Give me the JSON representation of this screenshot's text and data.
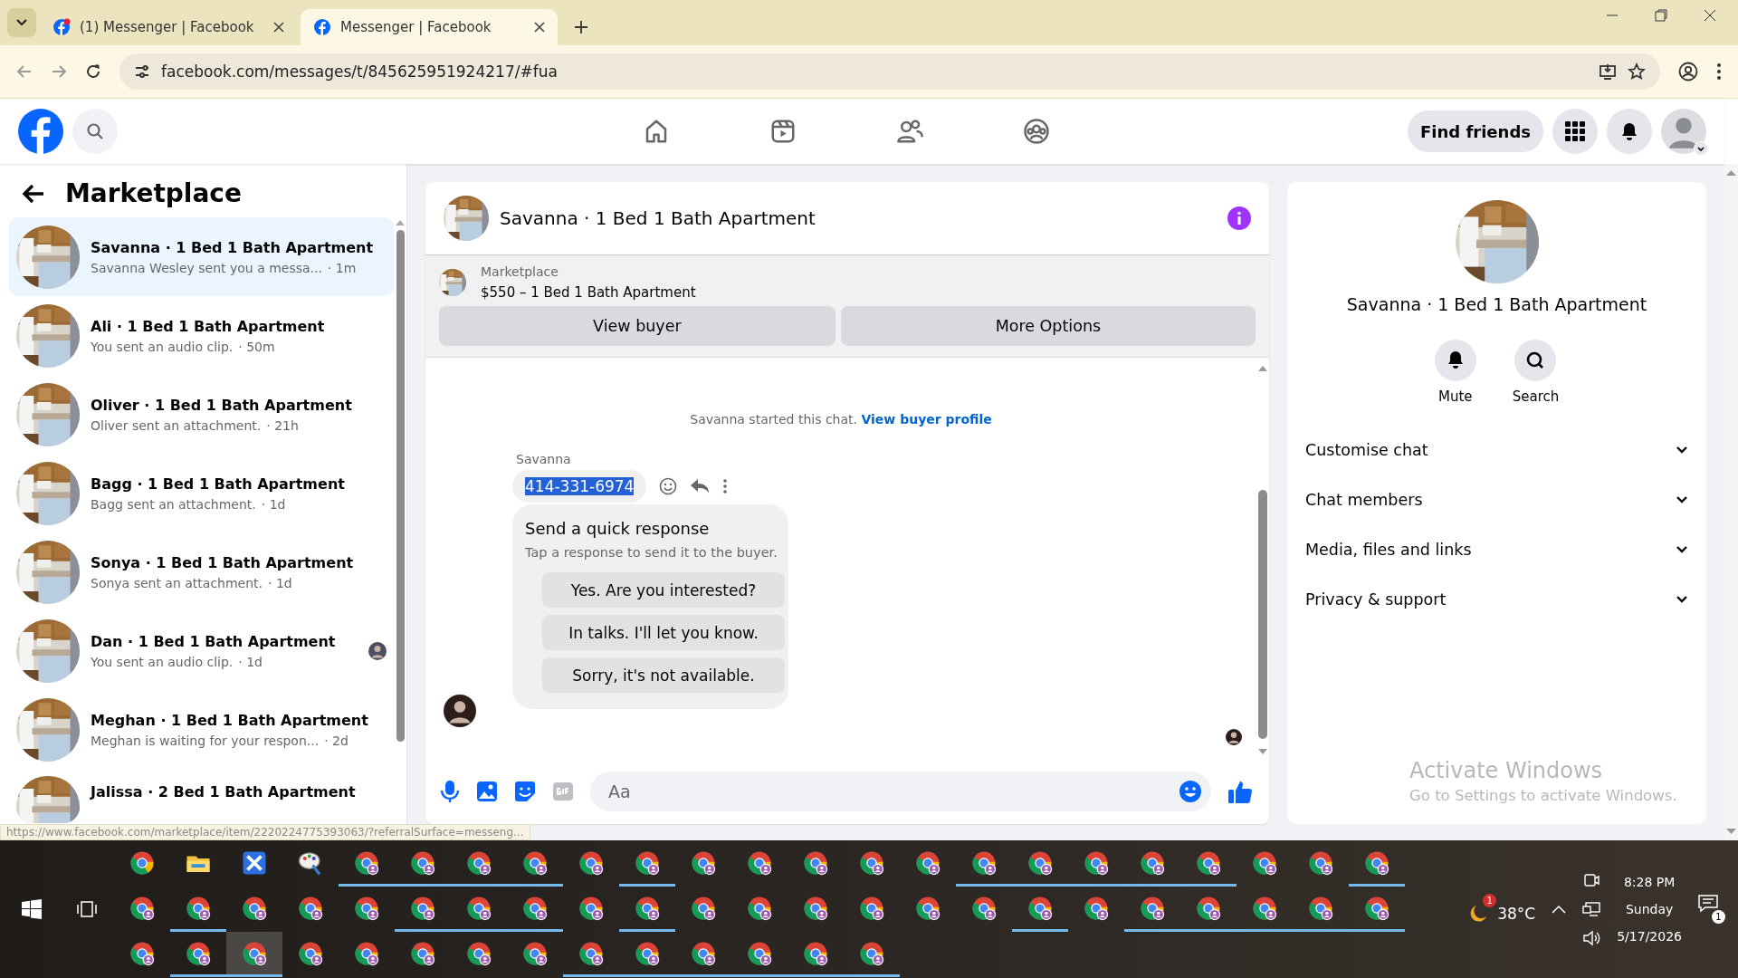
{
  "browser": {
    "tabs": [
      {
        "title": "(1) Messenger | Facebook",
        "selected": false,
        "notification": true
      },
      {
        "title": "Messenger | Facebook",
        "selected": true,
        "notification": false
      }
    ],
    "url": "facebook.com/messages/t/845625951924217/#fua"
  },
  "header": {
    "nav": [
      {
        "kind": "home"
      },
      {
        "kind": "video"
      },
      {
        "kind": "friends"
      },
      {
        "kind": "groups"
      }
    ],
    "find_friends": "Find friends"
  },
  "sidebar": {
    "title": "Marketplace",
    "chats": [
      {
        "title": "Savanna · 1 Bed 1 Bath Apartment",
        "preview": "Savanna Wesley sent you a messa...",
        "time": "· 1m",
        "selected": true,
        "seen": false
      },
      {
        "title": "Ali · 1 Bed 1 Bath Apartment",
        "preview": "You sent an audio clip.",
        "time": "· 50m",
        "selected": false,
        "seen": false
      },
      {
        "title": "Oliver · 1 Bed 1 Bath Apartment",
        "preview": "Oliver sent an attachment.",
        "time": "· 21h",
        "selected": false,
        "seen": false
      },
      {
        "title": "Bagg · 1 Bed 1 Bath Apartment",
        "preview": "Bagg sent an attachment.",
        "time": "· 1d",
        "selected": false,
        "seen": false
      },
      {
        "title": "Sonya · 1 Bed 1 Bath Apartment",
        "preview": "Sonya sent an attachment.",
        "time": "· 1d",
        "selected": false,
        "seen": false
      },
      {
        "title": "Dan · 1 Bed 1 Bath Apartment",
        "preview": "You sent an audio clip.",
        "time": "· 1d",
        "selected": false,
        "seen": true
      },
      {
        "title": "Meghan · 1 Bed 1 Bath Apartment",
        "preview": "Meghan is waiting for your respon...",
        "time": "· 2d",
        "selected": false,
        "seen": false
      },
      {
        "title": "Jalissa · 2 Bed 1 Bath Apartment",
        "selected": false,
        "seen": false
      }
    ]
  },
  "status_link": "https://www.facebook.com/marketplace/item/2220224775393063/?referralSurface=messeng...",
  "chat": {
    "title": "Savanna · 1 Bed 1 Bath Apartment",
    "listing": {
      "label": "Marketplace",
      "price": "$550 – 1 Bed 1 Bath Apartment"
    },
    "buttons": [
      "View buyer",
      "More Options"
    ],
    "notice": {
      "text": "Savanna started this chat.",
      "link": "View buyer profile"
    },
    "sender": "Savanna",
    "message": {
      "text": "414-331-6974",
      "highlighted": true
    },
    "quick_response": {
      "title": "Send a quick response",
      "subtitle": "Tap a response to send it to the buyer.",
      "options": [
        "Yes. Are you interested?",
        "In talks. I'll let you know.",
        "Sorry, it's not available."
      ]
    },
    "composer": {
      "placeholder": "Aa"
    }
  },
  "info": {
    "title": "Savanna · 1 Bed 1 Bath Apartment",
    "actions": [
      {
        "kind": "mute",
        "label": "Mute"
      },
      {
        "kind": "search",
        "label": "Search"
      }
    ],
    "sections": [
      {
        "label": "Customise chat",
        "expanded": false
      },
      {
        "label": "Chat members",
        "expanded": false
      },
      {
        "label": "Media, files and links",
        "expanded": false
      },
      {
        "label": "Privacy & support",
        "expanded": false
      }
    ]
  },
  "activation": {
    "title": "Activate Windows",
    "subtitle": "Go to Settings to activate Windows."
  },
  "taskbar": {
    "rows": [
      [
        {
          "kind": "chrome",
          "running": false,
          "active": false
        },
        {
          "kind": "folder",
          "running": false,
          "active": false
        },
        {
          "kind": "xapp",
          "running": false,
          "active": false
        },
        {
          "kind": "paint",
          "running": false,
          "active": false
        },
        {
          "kind": "profile",
          "running": true,
          "active": false
        },
        {
          "kind": "profile",
          "running": true,
          "active": false
        },
        {
          "kind": "profile",
          "running": true,
          "active": false
        },
        {
          "kind": "profile",
          "running": true,
          "active": false
        },
        {
          "kind": "profile",
          "running": false,
          "active": false
        },
        {
          "kind": "profile",
          "running": true,
          "active": false
        },
        {
          "kind": "profile",
          "running": false,
          "active": false
        },
        {
          "kind": "profile",
          "running": false,
          "active": false
        },
        {
          "kind": "profile",
          "running": false,
          "active": false
        },
        {
          "kind": "profile",
          "running": false,
          "active": false
        },
        {
          "kind": "profile",
          "running": false,
          "active": false
        },
        {
          "kind": "profile",
          "running": true,
          "active": false
        },
        {
          "kind": "profile",
          "running": true,
          "active": false
        },
        {
          "kind": "profile",
          "running": true,
          "active": false
        },
        {
          "kind": "profile",
          "running": true,
          "active": false
        },
        {
          "kind": "profile",
          "running": true,
          "active": false
        },
        {
          "kind": "profile",
          "running": false,
          "active": false
        },
        {
          "kind": "profile",
          "running": false,
          "active": false
        },
        {
          "kind": "profile",
          "running": true,
          "active": false
        }
      ],
      [
        {
          "kind": "profile",
          "running": false,
          "active": false
        },
        {
          "kind": "profile",
          "running": true,
          "active": false
        },
        {
          "kind": "profile",
          "running": false,
          "active": false
        },
        {
          "kind": "profile",
          "running": false,
          "active": false
        },
        {
          "kind": "profile",
          "running": false,
          "active": false
        },
        {
          "kind": "profile",
          "running": true,
          "active": false
        },
        {
          "kind": "profile",
          "running": true,
          "active": false
        },
        {
          "kind": "profile",
          "running": true,
          "active": false
        },
        {
          "kind": "profile",
          "running": false,
          "active": false
        },
        {
          "kind": "profile",
          "running": true,
          "active": false
        },
        {
          "kind": "profile",
          "running": false,
          "active": false
        },
        {
          "kind": "profile",
          "running": false,
          "active": false
        },
        {
          "kind": "profile",
          "running": false,
          "active": false
        },
        {
          "kind": "profile",
          "running": false,
          "active": false
        },
        {
          "kind": "profile",
          "running": false,
          "active": false
        },
        {
          "kind": "profile",
          "running": false,
          "active": false
        },
        {
          "kind": "profile",
          "running": true,
          "active": false
        },
        {
          "kind": "profile",
          "running": false,
          "active": false
        },
        {
          "kind": "profile",
          "running": true,
          "active": false
        },
        {
          "kind": "profile",
          "running": true,
          "active": false
        },
        {
          "kind": "profile",
          "running": true,
          "active": false
        },
        {
          "kind": "profile",
          "running": true,
          "active": false
        },
        {
          "kind": "profile",
          "running": true,
          "active": false
        }
      ],
      [
        {
          "kind": "profile",
          "running": false,
          "active": false
        },
        {
          "kind": "profile",
          "running": true,
          "active": false
        },
        {
          "kind": "profile",
          "running": true,
          "active": true
        },
        {
          "kind": "profile",
          "running": false,
          "active": false
        },
        {
          "kind": "profile",
          "running": false,
          "active": false
        },
        {
          "kind": "profile",
          "running": false,
          "active": false
        },
        {
          "kind": "profile",
          "running": false,
          "active": false
        },
        {
          "kind": "profile",
          "running": false,
          "active": false
        },
        {
          "kind": "profile",
          "running": true,
          "active": false
        },
        {
          "kind": "profile",
          "running": true,
          "active": false
        },
        {
          "kind": "profile",
          "running": true,
          "active": false
        },
        {
          "kind": "profile",
          "running": true,
          "active": false
        },
        {
          "kind": "profile",
          "running": true,
          "active": false
        },
        {
          "kind": "profile",
          "running": true,
          "active": false
        }
      ]
    ],
    "weather": {
      "temperature": "38°C",
      "badge": "1"
    },
    "clock": {
      "time": "8:28 PM",
      "day": "Sunday",
      "date": "5/17/2026"
    },
    "notification_count": "1"
  }
}
